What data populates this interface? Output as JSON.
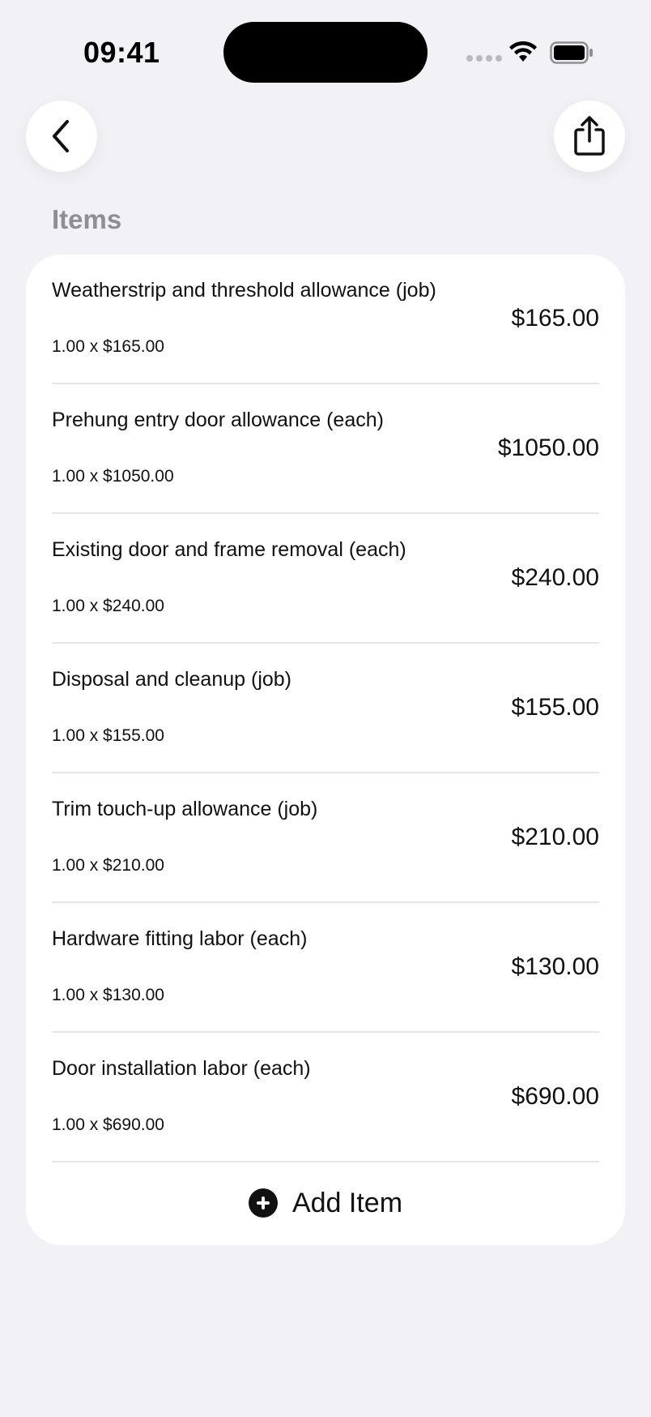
{
  "status_bar": {
    "time": "09:41"
  },
  "nav": {
    "back_icon": "chevron-left-icon",
    "share_icon": "share-icon"
  },
  "section": {
    "title": "Items"
  },
  "items": [
    {
      "name": "Weatherstrip and threshold allowance (job)",
      "qty": "1.00 x $165.00",
      "amount": "$165.00"
    },
    {
      "name": "Prehung entry door allowance (each)",
      "qty": "1.00 x $1050.00",
      "amount": "$1050.00"
    },
    {
      "name": "Existing door and frame removal (each)",
      "qty": "1.00 x $240.00",
      "amount": "$240.00"
    },
    {
      "name": "Disposal and cleanup (job)",
      "qty": "1.00 x $155.00",
      "amount": "$155.00"
    },
    {
      "name": "Trim touch-up allowance (job)",
      "qty": "1.00 x $210.00",
      "amount": "$210.00"
    },
    {
      "name": "Hardware fitting labor (each)",
      "qty": "1.00 x $130.00",
      "amount": "$130.00"
    },
    {
      "name": "Door installation labor (each)",
      "qty": "1.00 x $690.00",
      "amount": "$690.00"
    }
  ],
  "add_item": {
    "label": "Add Item",
    "icon": "plus-circle-icon"
  },
  "colors": {
    "background": "#f1f1f6",
    "card": "#ffffff",
    "section_title": "#8e8e93",
    "divider": "#e4e4e9"
  }
}
